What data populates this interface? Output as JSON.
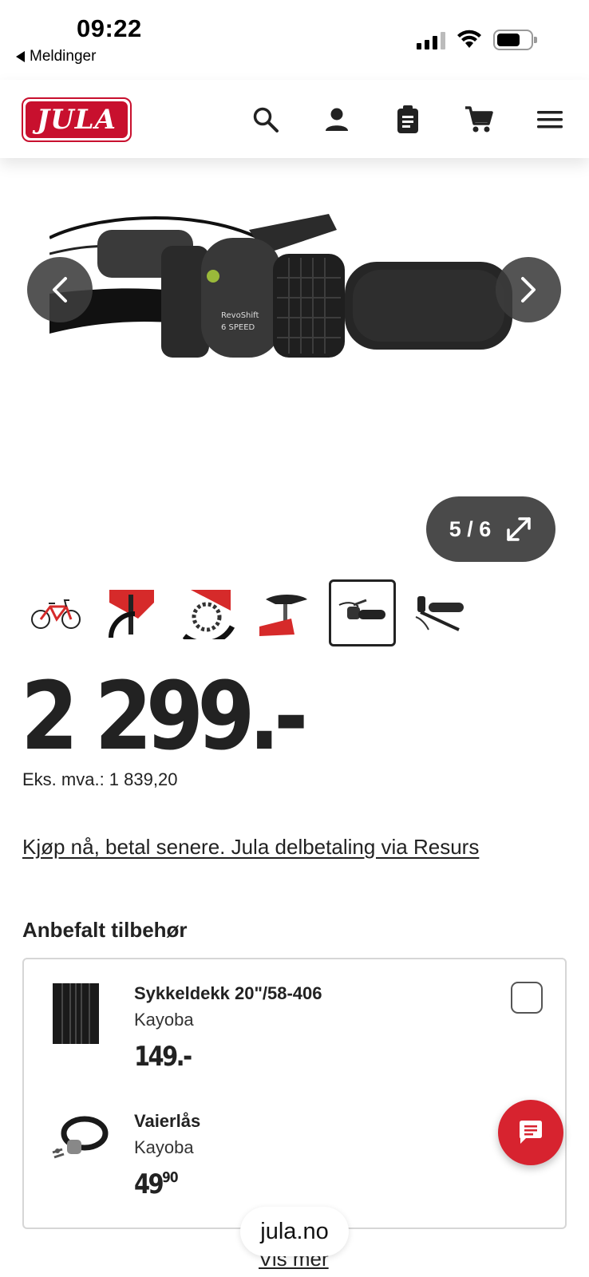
{
  "status_bar": {
    "time": "09:22",
    "back_app": "Meldinger",
    "icons": [
      "signal-icon",
      "wifi-icon",
      "battery-icon"
    ]
  },
  "header": {
    "logo_text": "JULA",
    "icons": [
      "search-icon",
      "account-icon",
      "clipboard-icon",
      "cart-icon",
      "menu-icon"
    ],
    "brand_color": "#c8102e"
  },
  "gallery": {
    "counter": "5 / 6",
    "current_index": 5,
    "total": 6,
    "prev_icon": "chevron-left-icon",
    "next_icon": "chevron-right-icon",
    "expand_icon": "expand-icon"
  },
  "thumbnails": [
    {
      "name": "bike-thumb",
      "active": false
    },
    {
      "name": "fork-thumb",
      "active": false
    },
    {
      "name": "gear-thumb",
      "active": false
    },
    {
      "name": "saddle-thumb",
      "active": false
    },
    {
      "name": "grip-shifter-thumb",
      "active": true
    },
    {
      "name": "brake-lever-thumb",
      "active": false
    }
  ],
  "price": {
    "main": "2 299.-",
    "vat_label": "Eks. mva.: 1 839,20"
  },
  "financing_link": "Kjøp nå, betal senere. Jula delbetaling via Resurs",
  "accessories": {
    "title": "Anbefalt tilbehør",
    "items": [
      {
        "name": "Sykkeldekk 20\"/58-406",
        "brand": "Kayoba",
        "price_main": "149.-",
        "price_cents": ""
      },
      {
        "name": "Vaierlås",
        "brand": "Kayoba",
        "price_main": "49",
        "price_cents": "90"
      }
    ]
  },
  "chat_button_icon": "chat-icon",
  "chat_color": "#d7232f",
  "url_label": "jula.no",
  "show_more": "Vis mer"
}
